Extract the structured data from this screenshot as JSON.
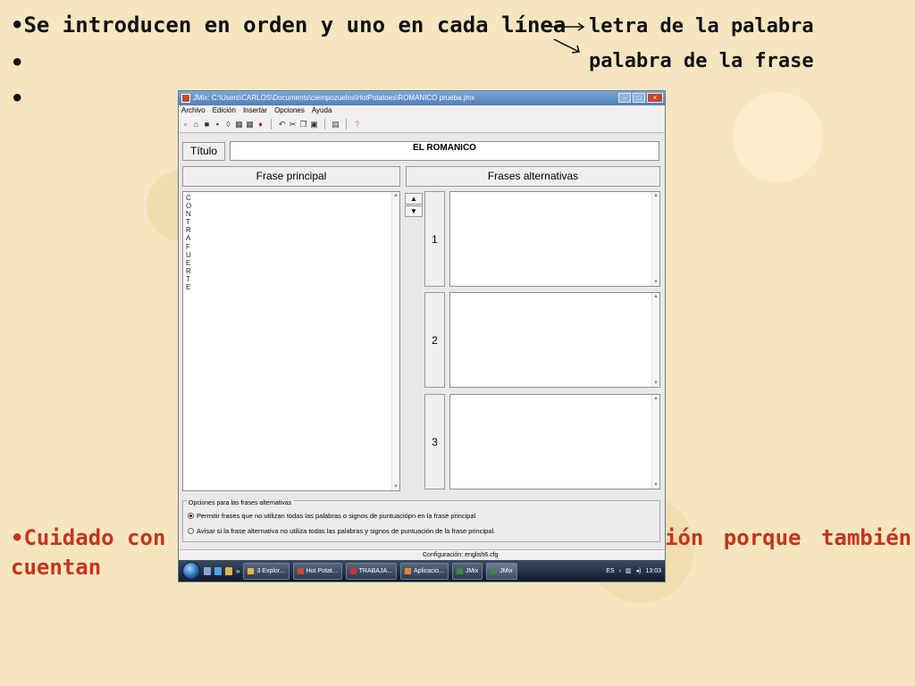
{
  "slide": {
    "line1": "•Se introducen en orden y uno en cada línea",
    "line1_target1": "letra de la palabra",
    "line2_bullet": "•",
    "line2_target2": "palabra de la frase",
    "line3_bullet": "•",
    "bottom_left": "•Cuidado con",
    "bottom_right": "ión porque también",
    "bottom_line2": "cuentan"
  },
  "window": {
    "title": "JMix: C:\\Users\\CARLOS\\Documents\\ciempozuelos\\HotPotatoes\\ROMANICO prueba.jmx",
    "menu": [
      "Archivo",
      "Edición",
      "Insertar",
      "Opciones",
      "Ayuda"
    ],
    "titulo_label": "Título",
    "titulo_value": "EL ROMANICO",
    "frase_principal_label": "Frase principal",
    "frases_alternativas_label": "Frases alternativas",
    "main_letters": [
      "C",
      "O",
      "N",
      "T",
      "R",
      "A",
      "F",
      "U",
      "E",
      "R",
      "T",
      "E"
    ],
    "alt_numbers": [
      "1",
      "2",
      "3"
    ],
    "options_legend": "Opciones para las frases alternativas",
    "option1": "Permitir frases que no utilizan todas las palabras o signos de puntuaciópn en la frase principal",
    "option2": "Avisar si la frase alternativa no utiliza todas las palabras y signos de puntuación de la frase principal.",
    "status": "Configuración: english6.cfg",
    "taskbar": {
      "tasks": [
        "3 Explor...",
        "Hot Potat...",
        "TRABAJA...",
        "Aplicacio...",
        "JMix",
        "JMix"
      ],
      "lang": "ES",
      "clock": "13:03"
    }
  }
}
